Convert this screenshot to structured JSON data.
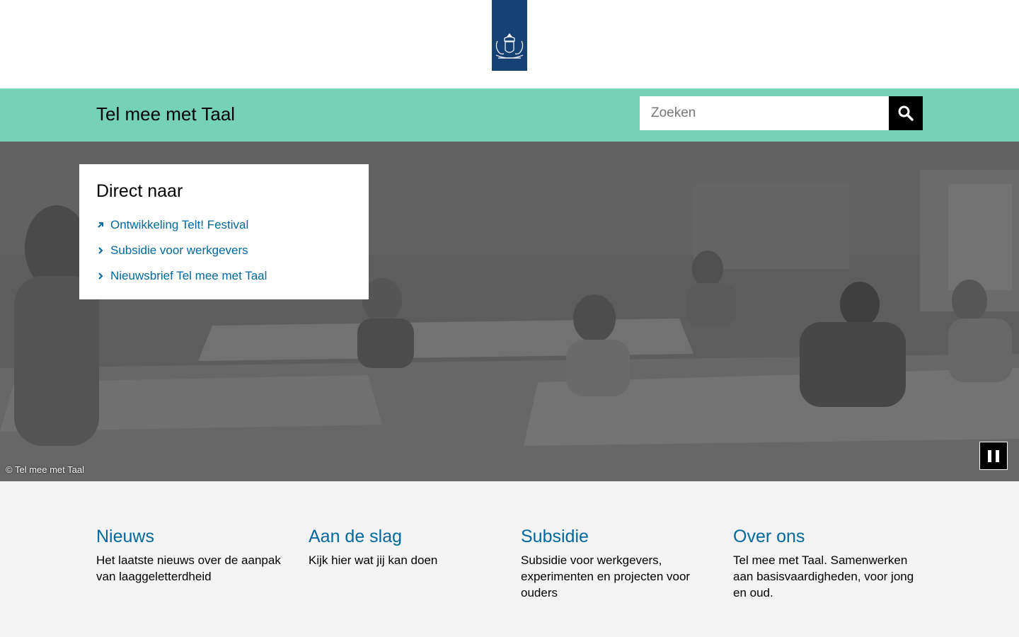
{
  "logo": {
    "alt": "Rijksoverheid logo",
    "icon": "coat-of-arms"
  },
  "header": {
    "title": "Tel mee met Taal"
  },
  "search": {
    "placeholder": "Zoeken",
    "value": "",
    "button_icon": "search-icon"
  },
  "direct": {
    "title": "Direct naar",
    "items": [
      {
        "label": "Ontwikkeling Telt! Festival",
        "icon": "external-arrow-icon"
      },
      {
        "label": "Subsidie voor werkgevers",
        "icon": "chevron-right-icon"
      },
      {
        "label": "Nieuwsbrief Tel mee met Taal",
        "icon": "chevron-right-icon"
      }
    ]
  },
  "hero": {
    "caption": "© Tel mee met Taal",
    "pause_icon": "pause-icon"
  },
  "cards": [
    {
      "title": "Nieuws",
      "text": "Het laatste nieuws over de aanpak van laaggeletterdheid"
    },
    {
      "title": "Aan de slag",
      "text": "Kijk hier wat jij kan doen"
    },
    {
      "title": "Subsidie",
      "text": "Subsidie voor werkgevers, experimenten en projecten voor ouders"
    },
    {
      "title": "Over ons",
      "text": "Tel mee met Taal. Samenwerken aan basisvaardigheden, voor jong en oud."
    }
  ],
  "colors": {
    "brand_blue": "#154273",
    "link_blue": "#01689b",
    "header_green": "#76d2b6",
    "search_button": "#000000"
  }
}
